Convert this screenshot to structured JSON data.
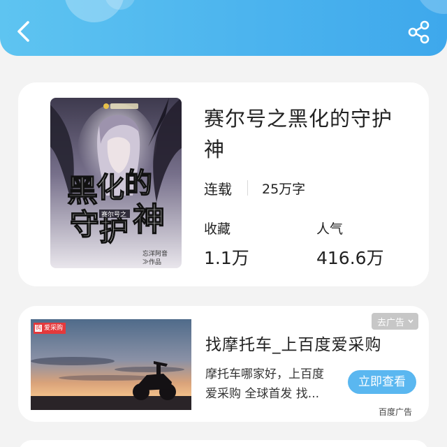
{
  "header": {
    "back_icon": "chevron-left-icon",
    "share_icon": "share-icon",
    "gradient": [
      "#5ec4f1",
      "#3ea8ec"
    ]
  },
  "book": {
    "title": "赛尔号之黑化的守护神",
    "status": "连载",
    "word_count": "25万字",
    "favorites_label": "收藏",
    "favorites_value": "1.1万",
    "popularity_label": "人气",
    "popularity_value": "416.6万",
    "cover": {
      "title_art": "黑化的守护神",
      "series": "赛尔号之",
      "author": "忘洋阿音",
      "credit": "≫作品"
    }
  },
  "ad": {
    "brand": "爱采购",
    "close_label": "去广告",
    "title": "找摩托车_上百度爱采购",
    "description": "摩托车哪家好，上百度爱采购 全球首发 找摩托车",
    "cta_label": "立即查看",
    "source": "百度广告",
    "accent": "#5ab7f0"
  }
}
